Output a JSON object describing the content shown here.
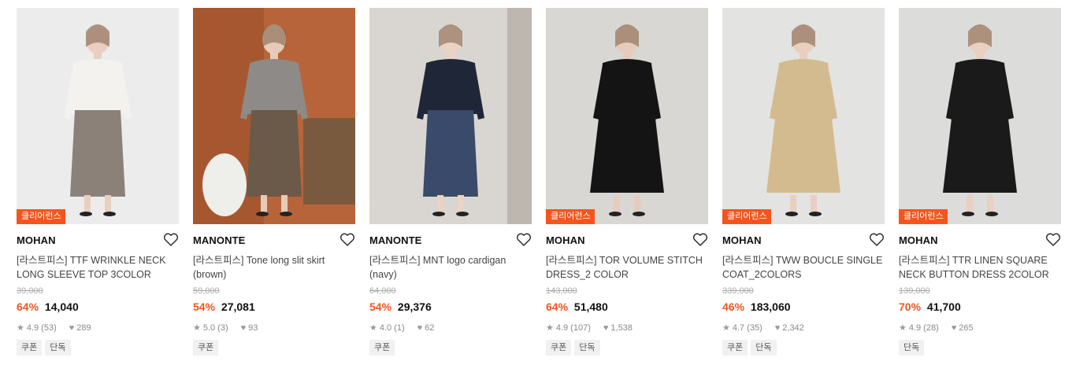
{
  "products": [
    {
      "brand": "MOHAN",
      "badge": "클리어런스",
      "name": "[라스트피스] TTF WRINKLE NECK LONG SLEEVE TOP 3COLOR",
      "original_price": "39,000",
      "discount": "64%",
      "price": "14,040",
      "rating": "4.9",
      "reviews": "(53)",
      "likes": "289",
      "tags": [
        "쿠폰",
        "단독"
      ],
      "colors": {
        "bg": "#ececec",
        "top": "#f3f2ee",
        "bottom": "#8c8178",
        "skin": "#e8cfc0"
      }
    },
    {
      "brand": "MANONTE",
      "badge": "",
      "name": "[라스트피스] Tone long slit skirt (brown)",
      "original_price": "59,000",
      "discount": "54%",
      "price": "27,081",
      "rating": "5.0",
      "reviews": "(3)",
      "likes": "93",
      "tags": [
        "쿠폰"
      ],
      "colors": {
        "bg": "#b8643a",
        "top": "#8d8a88",
        "bottom": "#6b5a4a",
        "skin": "#e6cbb8"
      }
    },
    {
      "brand": "MANONTE",
      "badge": "",
      "name": "[라스트피스] MNT logo cardigan (navy)",
      "original_price": "64,000",
      "discount": "54%",
      "price": "29,376",
      "rating": "4.0",
      "reviews": "(1)",
      "likes": "62",
      "tags": [
        "쿠폰"
      ],
      "colors": {
        "bg": "#d9d6d2",
        "top": "#1f2638",
        "bottom": "#3a4a6b",
        "skin": "#ead2c4"
      }
    },
    {
      "brand": "MOHAN",
      "badge": "클리어런스",
      "name": "[라스트피스] TOR VOLUME STITCH DRESS_2 COLOR",
      "original_price": "143,000",
      "discount": "64%",
      "price": "51,480",
      "rating": "4.9",
      "reviews": "(107)",
      "likes": "1,538",
      "tags": [
        "쿠폰",
        "단독"
      ],
      "colors": {
        "bg": "#d8d7d3",
        "top": "#141414",
        "bottom": "#141414",
        "skin": "#e6ccbd"
      }
    },
    {
      "brand": "MOHAN",
      "badge": "클리어런스",
      "name": "[라스트피스] TWW BOUCLE SINGLE COAT_2COLORS",
      "original_price": "339,000",
      "discount": "46%",
      "price": "183,060",
      "rating": "4.7",
      "reviews": "(35)",
      "likes": "2,342",
      "tags": [
        "쿠폰",
        "단독"
      ],
      "colors": {
        "bg": "#e3e3e1",
        "top": "#d4bb8f",
        "bottom": "#d4bb8f",
        "skin": "#e8cfc0"
      }
    },
    {
      "brand": "MOHAN",
      "badge": "클리어런스",
      "name": "[라스트피스] TTR LINEN SQUARE NECK BUTTON DRESS 2COLOR",
      "original_price": "139,000",
      "discount": "70%",
      "price": "41,700",
      "rating": "4.9",
      "reviews": "(28)",
      "likes": "265",
      "tags": [
        "단독"
      ],
      "colors": {
        "bg": "#dcdcda",
        "top": "#1a1a1a",
        "bottom": "#1a1a1a",
        "skin": "#e9d0c2"
      }
    }
  ]
}
